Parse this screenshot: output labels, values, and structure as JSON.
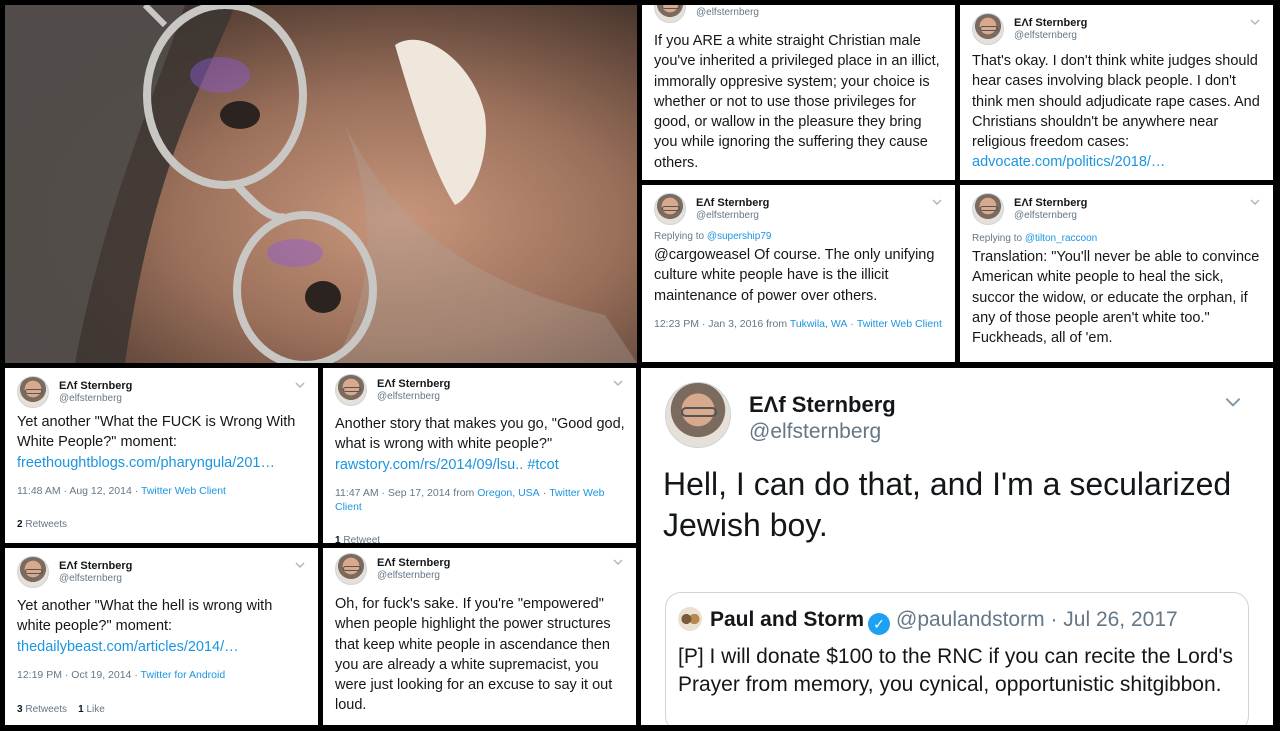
{
  "author": {
    "name": "ΕΛf Sternberg",
    "handle": "@elfsternberg"
  },
  "tweets": {
    "t1": {
      "body": "If you ARE a white straight Christian male you've inherited a privileged place in an illict, immorally oppresive system; your choice is whether or not to use those privileges for good, or wallow in the pleasure they bring you while ignoring the suffering they cause others."
    },
    "t2": {
      "body": "That's okay. I don't think white judges should hear cases involving black people. I don't think men should adjudicate rape cases. And Christians shouldn't be anywhere near religious freedom cases: ",
      "link": "advocate.com/politics/2018/…"
    },
    "t3": {
      "reply_prefix": "Replying to ",
      "reply_to": "@supership79",
      "body": "@cargoweasel Of course. The only unifying culture white people have is the illicit maintenance of power over others.",
      "time": "12:23 PM · Jan 3, 2016 from ",
      "location": "Tukwila, WA",
      "client": "Twitter Web Client"
    },
    "t4": {
      "reply_prefix": "Replying to ",
      "reply_to": "@tilton_raccoon",
      "body": "Translation: \"You'll never be able to convince American white people to heal the sick, succor the widow, or educate the orphan, if any of those people aren't white too.\" Fuckheads, all of 'em."
    },
    "t5": {
      "body": "Yet another \"What the FUCK is Wrong With White People?\" moment: ",
      "link": "freethoughtblogs.com/pharyngula/201…",
      "time": "11:48 AM · Aug 12, 2014 · ",
      "client": "Twitter Web Client",
      "retweets_count": "2",
      "retweets_label": "Retweets"
    },
    "t6": {
      "body": "Another story that makes you go, \"Good god, what is wrong with white people?\" ",
      "link": "rawstory.com/rs/2014/09/lsu..",
      "hashtag": "#tcot",
      "time": "11:47 AM · Sep 17, 2014 from ",
      "location": "Oregon, USA",
      "client": "Twitter Web Client",
      "retweets_count": "1",
      "retweets_label": "Retweet"
    },
    "t7": {
      "body": "Yet another \"What the hell is wrong with white people?\" moment: ",
      "link": "thedailybeast.com/articles/2014/…",
      "time": "12:19 PM · Oct 19, 2014 · ",
      "client": "Twitter for Android",
      "retweets_count": "3",
      "retweets_label": "Retweets",
      "likes_count": "1",
      "likes_label": "Like"
    },
    "t8": {
      "body": "Oh, for fuck's sake. If you're \"empowered\" when people highlight the power structures that keep white people in ascendance then you are already a white supremacist, you were just looking for an excuse to say it out loud."
    },
    "big": {
      "name": "ΕΛf Sternberg",
      "handle": "@elfsternberg",
      "body": "Hell, I can do that, and I'm a secularized Jewish boy.",
      "quote": {
        "name": "Paul and Storm",
        "handle": "@paulandstorm",
        "date": "· Jul 26, 2017",
        "body": "[P] I will donate $100 to the RNC if you can recite the Lord's Prayer from memory, you cynical, opportunistic shitgibbon."
      }
    }
  },
  "colors": {
    "link": "#1b95e0",
    "muted": "#657786",
    "text": "#14171a",
    "verified": "#1da1f2",
    "background": "#000000"
  },
  "icons": {
    "chevron": "chevron-down-icon",
    "verified": "verified-badge-icon"
  }
}
